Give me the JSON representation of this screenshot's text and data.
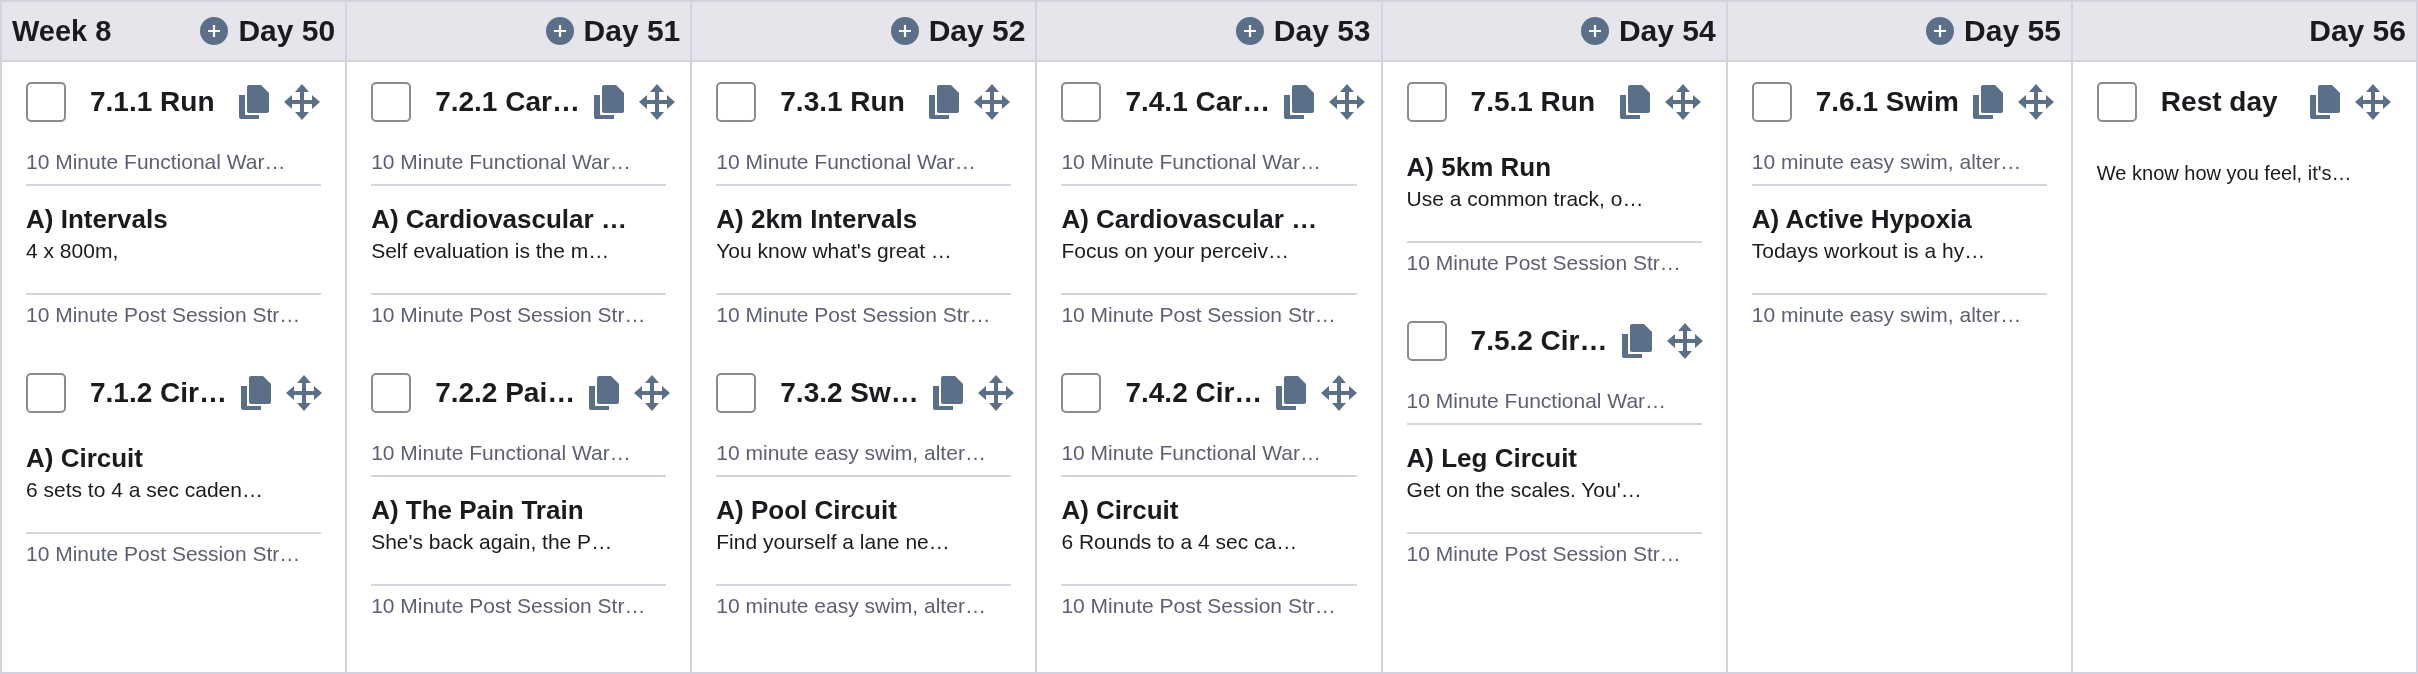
{
  "columns": [
    {
      "week": "Week 8",
      "add_button": true,
      "day": "Day 50",
      "workouts": [
        {
          "checked": false,
          "title": "7.1.1 Run",
          "sections": [
            {
              "kind": "warmup",
              "text": "10 Minute Functional War…"
            },
            {
              "kind": "block",
              "title": "A) Intervals",
              "text": "4 x 800m,"
            },
            {
              "kind": "cooldown",
              "text": "10 Minute Post Session Str…"
            }
          ]
        },
        {
          "checked": false,
          "title": "7.1.2 Cir…",
          "sections": [
            {
              "kind": "block",
              "title": "A) Circuit",
              "text": "6 sets to 4 a sec caden…"
            },
            {
              "kind": "cooldown",
              "text": "10 Minute Post Session Str…"
            }
          ]
        }
      ]
    },
    {
      "add_button": true,
      "day": "Day 51",
      "workouts": [
        {
          "checked": false,
          "title": "7.2.1 Car…",
          "sections": [
            {
              "kind": "warmup",
              "text": "10 Minute Functional War…"
            },
            {
              "kind": "block",
              "title": "A) Cardiovascular …",
              "text": "Self evaluation is the m…"
            },
            {
              "kind": "cooldown",
              "text": "10 Minute Post Session Str…"
            }
          ]
        },
        {
          "checked": false,
          "title": "7.2.2 Pai…",
          "sections": [
            {
              "kind": "warmup",
              "text": "10 Minute Functional War…"
            },
            {
              "kind": "block",
              "title": "A) The Pain Train",
              "text": "She's back again, the P…"
            },
            {
              "kind": "cooldown",
              "text": "10 Minute Post Session Str…"
            }
          ]
        }
      ]
    },
    {
      "add_button": true,
      "day": "Day 52",
      "workouts": [
        {
          "checked": false,
          "title": "7.3.1 Run",
          "sections": [
            {
              "kind": "warmup",
              "text": "10 Minute Functional War…"
            },
            {
              "kind": "block",
              "title": "A) 2km Intervals",
              "text": "You know what's great …"
            },
            {
              "kind": "cooldown",
              "text": "10 Minute Post Session Str…"
            }
          ]
        },
        {
          "checked": false,
          "title": "7.3.2 Sw…",
          "sections": [
            {
              "kind": "warmup",
              "text": "10 minute easy swim, alter…"
            },
            {
              "kind": "block",
              "title": "A) Pool Circuit",
              "text": "Find yourself a lane ne…"
            },
            {
              "kind": "cooldown",
              "text": "10 minute easy swim, alter…"
            }
          ]
        }
      ]
    },
    {
      "add_button": true,
      "day": "Day 53",
      "workouts": [
        {
          "checked": false,
          "title": "7.4.1 Car…",
          "sections": [
            {
              "kind": "warmup",
              "text": "10 Minute Functional War…"
            },
            {
              "kind": "block",
              "title": "A) Cardiovascular …",
              "text": "Focus on your perceiv…"
            },
            {
              "kind": "cooldown",
              "text": "10 Minute Post Session Str…"
            }
          ]
        },
        {
          "checked": false,
          "title": "7.4.2 Cir…",
          "sections": [
            {
              "kind": "warmup",
              "text": "10 Minute Functional War…"
            },
            {
              "kind": "block",
              "title": "A) Circuit",
              "text": "6 Rounds to a 4 sec ca…"
            },
            {
              "kind": "cooldown",
              "text": "10 Minute Post Session Str…"
            }
          ]
        }
      ]
    },
    {
      "add_button": true,
      "day": "Day 54",
      "workouts": [
        {
          "checked": false,
          "title": "7.5.1 Run",
          "sections": [
            {
              "kind": "block",
              "title": "A) 5km Run",
              "text": "Use a common track, o…"
            },
            {
              "kind": "cooldown",
              "text": "10 Minute Post Session Str…"
            }
          ]
        },
        {
          "checked": false,
          "title": "7.5.2 Cir…",
          "sections": [
            {
              "kind": "warmup",
              "text": "10 Minute Functional War…"
            },
            {
              "kind": "block",
              "title": "A) Leg Circuit",
              "text": "Get on the scales. You'…"
            },
            {
              "kind": "cooldown",
              "text": "10 Minute Post Session Str…"
            }
          ]
        }
      ]
    },
    {
      "add_button": true,
      "day": "Day 55",
      "workouts": [
        {
          "checked": false,
          "title": "7.6.1 Swim",
          "sections": [
            {
              "kind": "warmup",
              "text": "10 minute easy swim, alter…"
            },
            {
              "kind": "block",
              "title": "A) Active Hypoxia",
              "text": "Todays workout is a hy…"
            },
            {
              "kind": "cooldown",
              "text": "10 minute easy swim, alter…"
            }
          ]
        }
      ]
    },
    {
      "add_button": false,
      "day": "Day 56",
      "workouts": [
        {
          "checked": false,
          "title": "Rest day",
          "sections": [
            {
              "kind": "note",
              "text": "We know how you feel, it's…"
            }
          ]
        }
      ]
    }
  ]
}
